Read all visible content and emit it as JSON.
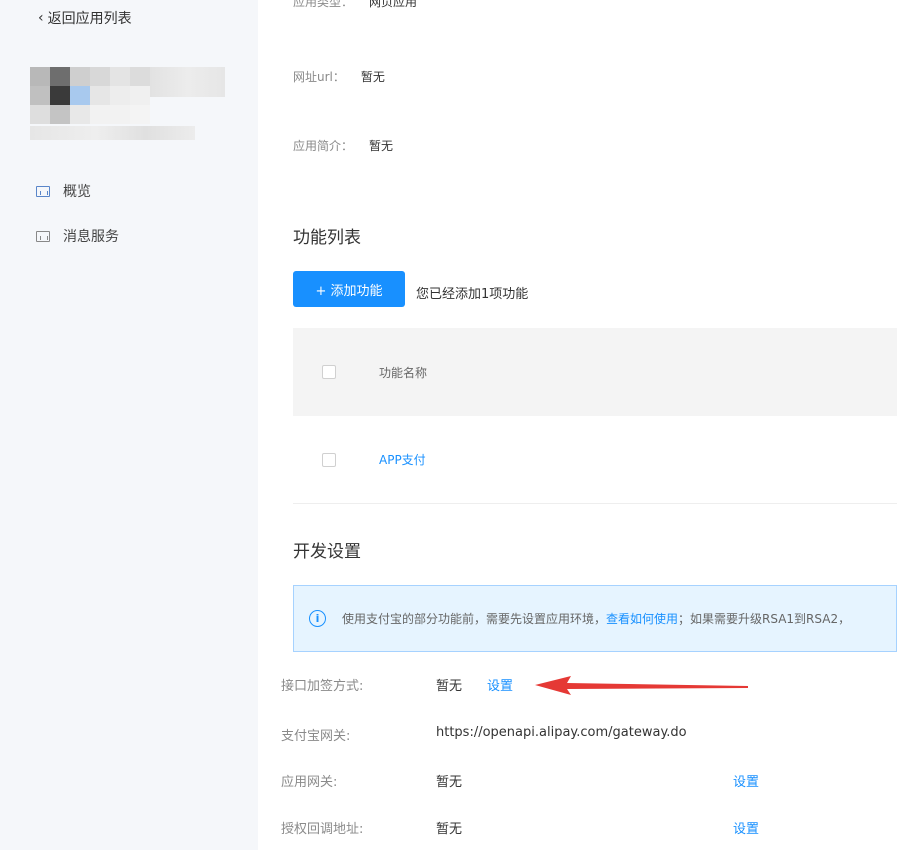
{
  "sidebar": {
    "back_label": "返回应用列表",
    "back_icon": "chevron-left-icon",
    "nav": [
      {
        "label": "概览",
        "icon": "chart-icon"
      },
      {
        "label": "消息服务",
        "icon": "chart-icon"
      }
    ]
  },
  "app_info": {
    "type_label": "应用类型：",
    "type_value": "网页应用",
    "url_label": "网址url：",
    "url_value": "暂无",
    "desc_label": "应用简介：",
    "desc_value": "暂无"
  },
  "features": {
    "title": "功能列表",
    "add_button": "+ 添加功能",
    "add_hint": "您已经添加1项功能",
    "column_name": "功能名称",
    "rows": [
      {
        "name": "APP支付"
      }
    ]
  },
  "dev_settings": {
    "title": "开发设置",
    "notice_text": "使用支付宝的部分功能前，需要先设置应用环境，",
    "notice_link": "查看如何使用",
    "notice_tail": "；如果需要升级RSA1到RSA2，",
    "rows": [
      {
        "label": "接口加签方式:",
        "value": "暂无",
        "link1": "设置",
        "link2": ""
      },
      {
        "label": "支付宝网关:",
        "value": "https://openapi.alipay.com/gateway.do",
        "link1": "",
        "link2": ""
      },
      {
        "label": "应用网关:",
        "value": "暂无",
        "link1": "",
        "link2": "设置"
      },
      {
        "label": "授权回调地址:",
        "value": "暂无",
        "link1": "",
        "link2": "设置"
      }
    ]
  },
  "colors": {
    "primary": "#1890ff",
    "arrow": "#e53935",
    "sidebar_bg": "#f5f7fa"
  }
}
